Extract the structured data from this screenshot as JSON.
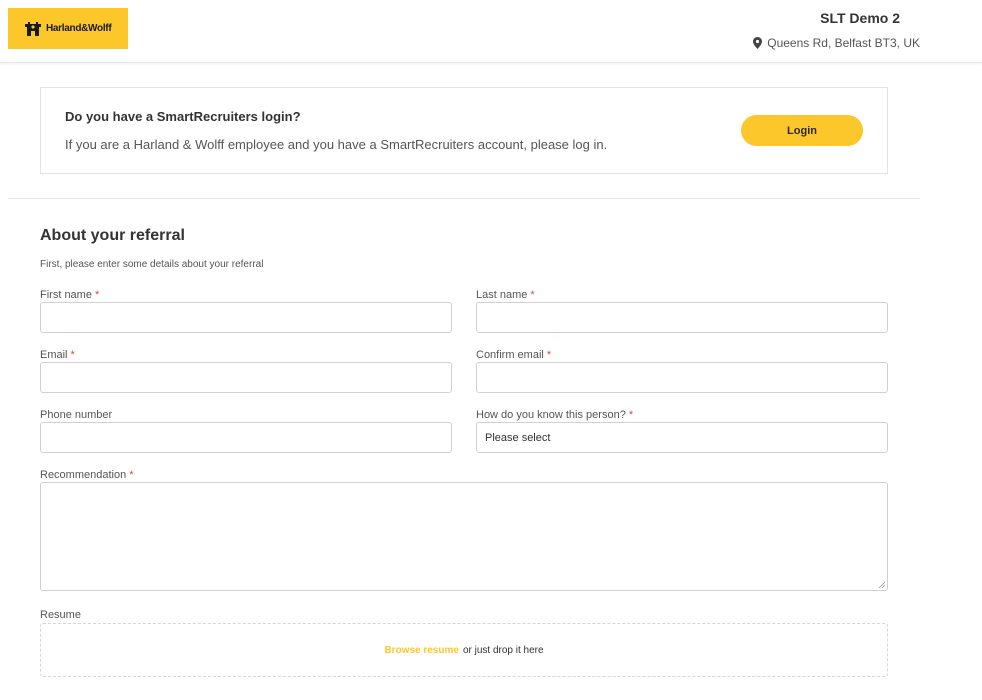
{
  "header": {
    "logo_text": "Harland&Wolff",
    "logo_icon": "hw-crest-icon",
    "job_title": "SLT Demo 2",
    "location_icon": "map-pin-icon",
    "location": "Queens Rd, Belfast BT3, UK"
  },
  "login_box": {
    "title": "Do you have a SmartRecruiters login?",
    "description": "If you are a Harland & Wolff employee and you have a SmartRecruiters account, please log in.",
    "button_label": "Login"
  },
  "referral": {
    "title": "About your referral",
    "subtitle": "First, please enter some details about your referral",
    "required_marker": "*",
    "fields": {
      "first_name": {
        "label": "First name",
        "value": ""
      },
      "last_name": {
        "label": "Last name",
        "value": ""
      },
      "email": {
        "label": "Email",
        "value": ""
      },
      "confirm_email": {
        "label": "Confirm email",
        "value": ""
      },
      "phone": {
        "label": "Phone number",
        "value": ""
      },
      "relationship": {
        "label": "How do you know this person?",
        "value": "Please select"
      },
      "recommendation": {
        "label": "Recommendation",
        "value": ""
      }
    },
    "resume": {
      "label": "Resume",
      "browse_text": "Browse resume",
      "drop_text": "or just drop it here"
    }
  },
  "colors": {
    "brand_yellow": "#fcc72b",
    "required_red": "#e0463b"
  }
}
